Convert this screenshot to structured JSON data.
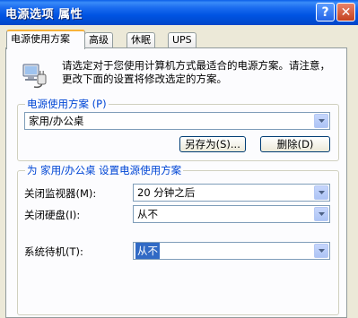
{
  "window": {
    "title": "电源选项 属性",
    "help_glyph": "?",
    "close_glyph": "✕"
  },
  "tabs": [
    {
      "label": "电源使用方案",
      "active": true
    },
    {
      "label": "高级",
      "active": false
    },
    {
      "label": "休眠",
      "active": false
    },
    {
      "label": "UPS",
      "active": false
    }
  ],
  "intro": {
    "icon": "power-plug-computer-icon",
    "text": "请选定对于您使用计算机方式最适合的电源方案。请注意，更改下面的设置将修改选定的方案。"
  },
  "scheme_group": {
    "label": "电源使用方案 (P)",
    "selected": "家用/办公桌",
    "save_as_label": "另存为(S)...",
    "delete_label": "删除(D)"
  },
  "settings_group": {
    "label": "为 家用/办公桌 设置电源使用方案",
    "rows": [
      {
        "label": "关闭监视器(M):",
        "value": "20 分钟之后"
      },
      {
        "label": "关闭硬盘(I):",
        "value": "从不"
      },
      {
        "label": "系统待机(T):",
        "value": "从不"
      }
    ]
  },
  "colors": {
    "titlebar": "#0054e3",
    "group_label": "#0046d5",
    "selection": "#316ac5"
  }
}
